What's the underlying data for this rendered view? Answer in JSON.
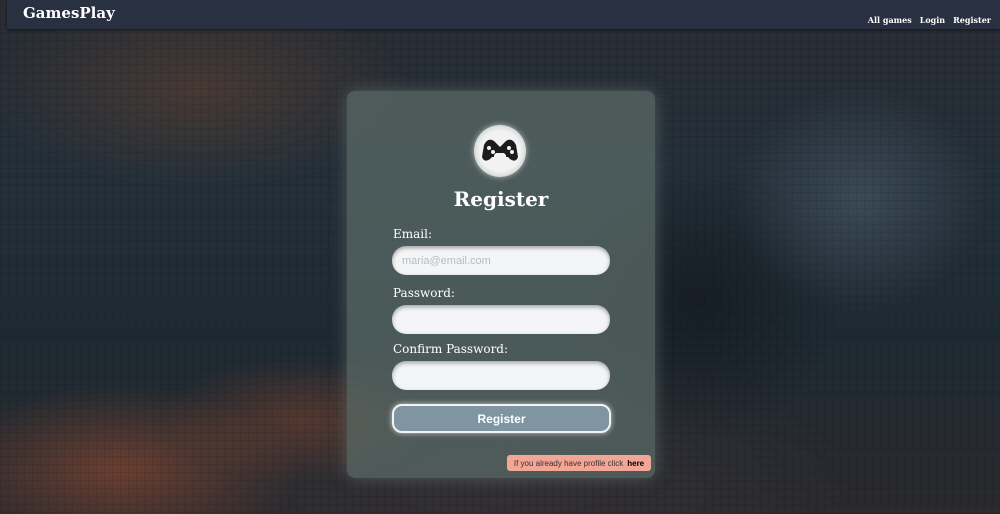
{
  "navbar": {
    "brand": "GamesPlay",
    "links": [
      {
        "label": "All games"
      },
      {
        "label": "Login"
      },
      {
        "label": "Register"
      }
    ]
  },
  "form": {
    "title": "Register",
    "logo_icon": "gamepad-logo-icon",
    "fields": [
      {
        "label": "Email:",
        "placeholder": "maria@email.com",
        "value": ""
      },
      {
        "label": "Password:",
        "placeholder": "",
        "value": ""
      },
      {
        "label": "Confirm Password:",
        "placeholder": "",
        "value": ""
      }
    ],
    "submit_label": "Register",
    "hint_text": "If you already have profile click",
    "hint_link": "here"
  },
  "colors": {
    "navbar": "#283041",
    "submit": "#7f96a2",
    "hint_bg": "#f3a596"
  }
}
